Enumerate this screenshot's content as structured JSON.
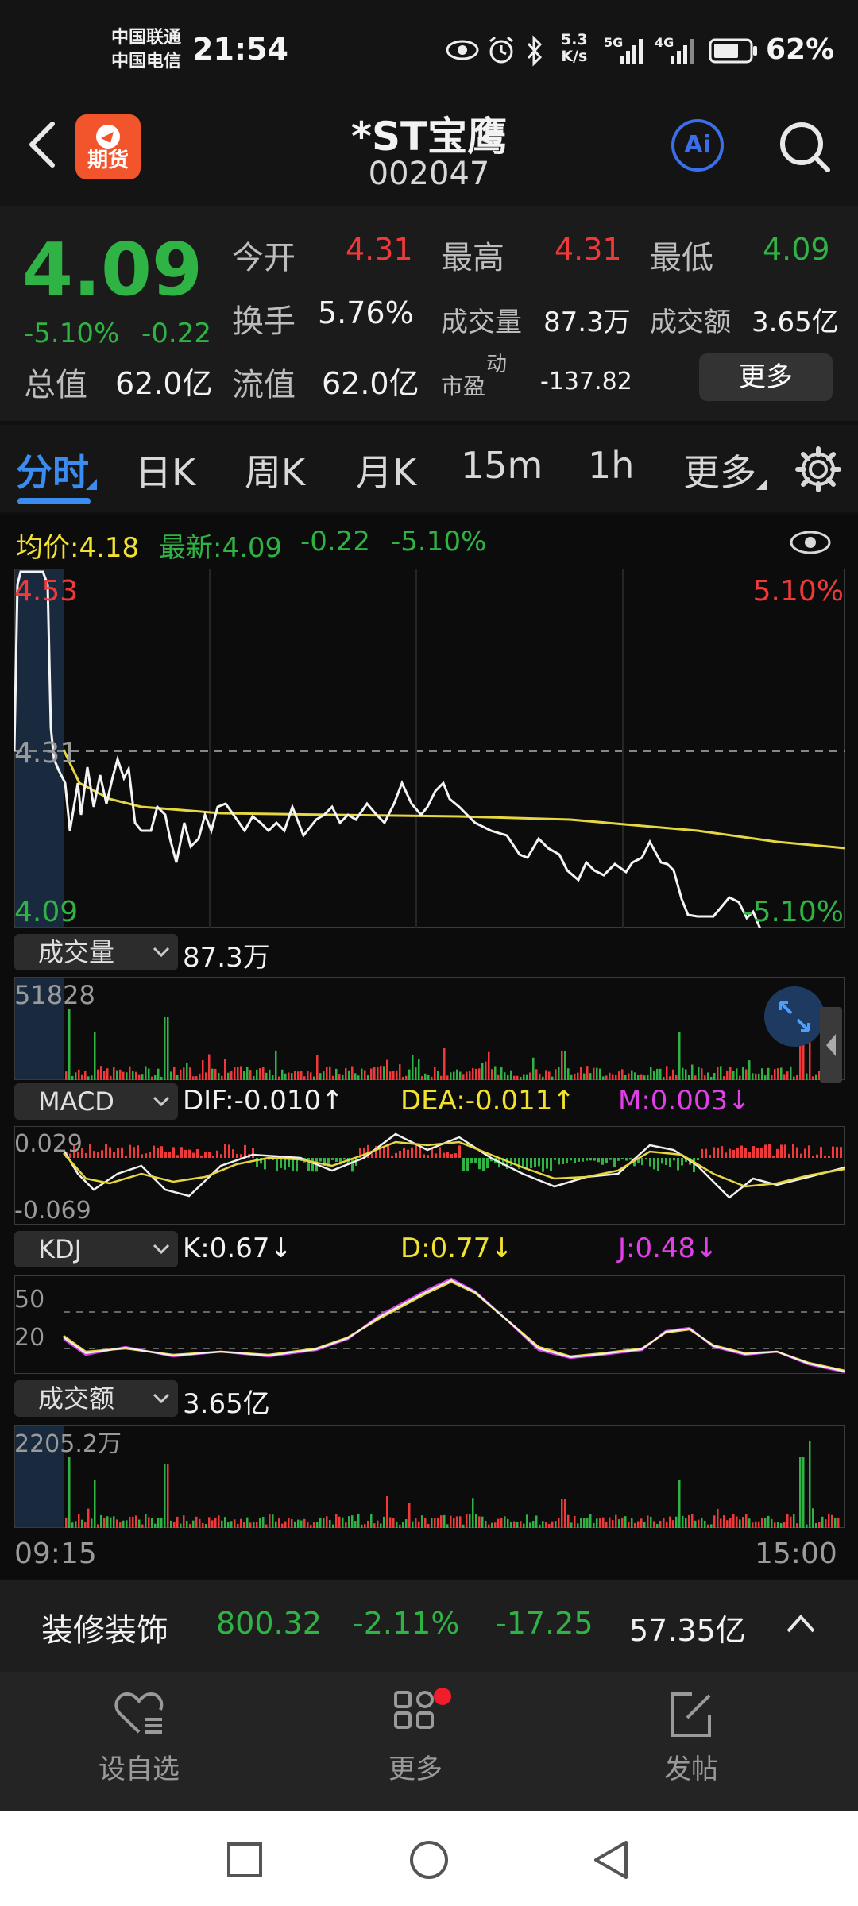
{
  "status_bar": {
    "carrier1": "中国联通",
    "carrier2": "中国电信",
    "time": "21:54",
    "net_speed_value": "5.3",
    "net_speed_unit": "K/s",
    "net1": "5G",
    "net2": "4G",
    "battery": "62%",
    "battery_level": 0.62
  },
  "header": {
    "logo_text": "期货",
    "title": "*ST宝鹰",
    "code": "002047",
    "ai_label": "Ai"
  },
  "quote": {
    "price": "4.09",
    "change_pct": "-5.10%",
    "change": "-0.22",
    "open_label": "今开",
    "open": "4.31",
    "high_label": "最高",
    "high": "4.31",
    "low_label": "最低",
    "low": "4.09",
    "turnover_label": "换手",
    "turnover": "5.76%",
    "volume_label": "成交量",
    "volume": "87.3万",
    "amount_label": "成交额",
    "amount": "3.65亿",
    "total_cap_label": "总值",
    "total_cap": "62.0亿",
    "float_cap_label": "流值",
    "float_cap": "62.0亿",
    "pe_label": "市盈",
    "pe_sup": "动",
    "pe": "-137.82",
    "more_label": "更多"
  },
  "tabs": [
    "分时",
    "日K",
    "周K",
    "月K",
    "15m",
    "1h",
    "更多"
  ],
  "chart": {
    "avg_price": "均价:4.18",
    "latest": "最新:4.09",
    "latest_change": "-0.22",
    "latest_pct": "-5.10%",
    "price_top": "4.53",
    "price_mid": "4.31",
    "price_bottom": "4.09",
    "pct_top": "5.10%",
    "pct_bottom": "-5.10%",
    "vol_label": "成交量",
    "vol_value": "87.3万",
    "vol_max": "51828",
    "macd_label": "MACD",
    "dif": "DIF:-0.010↑",
    "dea": "DEA:-0.011↑",
    "macd_m": "M:0.003↓",
    "macd_top": "0.029",
    "macd_bottom": "-0.069",
    "kdj_label": "KDJ",
    "k": "K:0.67↓",
    "d": "D:0.77↓",
    "j": "J:0.48↓",
    "kdj_50": "50",
    "kdj_20": "20",
    "amt_label": "成交额",
    "amt_value": "3.65亿",
    "amt_max": "2205.2万",
    "time_start": "09:15",
    "time_end": "15:00"
  },
  "sector": {
    "name": "装修装饰",
    "price": "800.32",
    "pct": "-2.11%",
    "change": "-17.25",
    "amount": "57.35亿"
  },
  "bottom_nav": [
    {
      "label": "设自选",
      "icon": "heart-list-icon"
    },
    {
      "label": "更多",
      "icon": "grid-icon"
    },
    {
      "label": "发帖",
      "icon": "edit-icon"
    }
  ],
  "colors": {
    "up": "#f03a3a",
    "down": "#2fb344",
    "avg": "#f2e230",
    "accent": "#3a6fe8"
  }
}
